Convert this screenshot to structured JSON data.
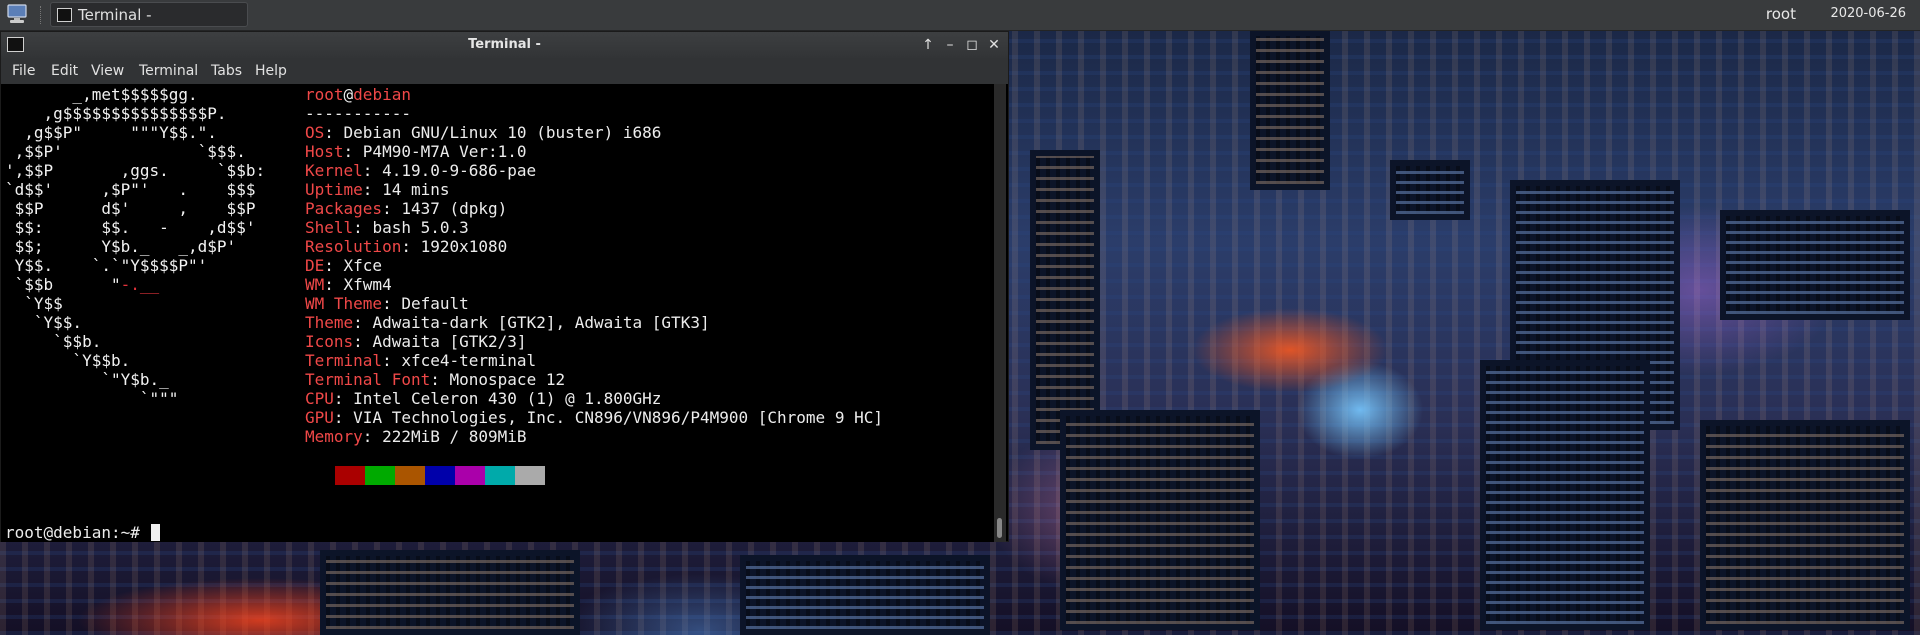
{
  "top_panel": {
    "taskbar_item": {
      "icon": "terminal-icon",
      "label": "Terminal -"
    },
    "user": "root",
    "clock": "2020-06-26"
  },
  "window": {
    "title": "Terminal -",
    "buttons": {
      "stick": "up-arrow-icon",
      "minimize": "minimize-icon",
      "maximize": "maximize-icon",
      "close": "close-icon"
    },
    "menu": [
      "File",
      "Edit",
      "View",
      "Terminal",
      "Tabs",
      "Help"
    ]
  },
  "neofetch": {
    "logo_lines": [
      "       _,met$$$$$gg.",
      "    ,g$$$$$$$$$$$$$$$P.",
      "  ,g$$P\"     \"\"\"Y$$.\".",
      " ,$$P'              `$$$.",
      "',$$P       ,ggs.     `$$b:",
      "`d$$'     ,$P\"'   .    $$$",
      " $$P      d$'     ,    $$P",
      " $$:      $$.   -    ,d$$'",
      " $$;      Y$b._   _,d$P'",
      " Y$$.    `.`\"Y$$$$P\"'",
      " `$$b      \"-.__",
      "  `Y$$",
      "   `Y$$.",
      "     `$$b.",
      "       `Y$$b.",
      "          `\"Y$b._",
      "              `\"\"\""
    ],
    "header": {
      "user": "root",
      "at": "@",
      "host": "debian",
      "separator": "-----------"
    },
    "info": [
      {
        "key": "OS",
        "value": "Debian GNU/Linux 10 (buster) i686"
      },
      {
        "key": "Host",
        "value": "P4M90-M7A Ver:1.0"
      },
      {
        "key": "Kernel",
        "value": "4.19.0-9-686-pae"
      },
      {
        "key": "Uptime",
        "value": "14 mins"
      },
      {
        "key": "Packages",
        "value": "1437 (dpkg)"
      },
      {
        "key": "Shell",
        "value": "bash 5.0.3"
      },
      {
        "key": "Resolution",
        "value": "1920x1080"
      },
      {
        "key": "DE",
        "value": "Xfce"
      },
      {
        "key": "WM",
        "value": "Xfwm4"
      },
      {
        "key": "WM Theme",
        "value": "Default"
      },
      {
        "key": "Theme",
        "value": "Adwaita-dark [GTK2], Adwaita [GTK3]"
      },
      {
        "key": "Icons",
        "value": "Adwaita [GTK2/3]"
      },
      {
        "key": "Terminal",
        "value": "xfce4-terminal"
      },
      {
        "key": "Terminal Font",
        "value": "Monospace 12"
      },
      {
        "key": "CPU",
        "value": "Intel Celeron 430 (1) @ 1.800GHz"
      },
      {
        "key": "GPU",
        "value": "VIA Technologies, Inc. CN896/VN896/P4M900 [Chrome 9 HC]"
      },
      {
        "key": "Memory",
        "value": "222MiB / 809MiB"
      }
    ],
    "palette": [
      "#aa0000",
      "#00aa00",
      "#aa5500",
      "#0000aa",
      "#aa00aa",
      "#00aaaa",
      "#aaaaaa"
    ]
  },
  "prompt": "root@debian:~#",
  "colors": {
    "accent": "#f04848",
    "terminal_bg": "#000000",
    "panel_bg": "#393b3d"
  }
}
